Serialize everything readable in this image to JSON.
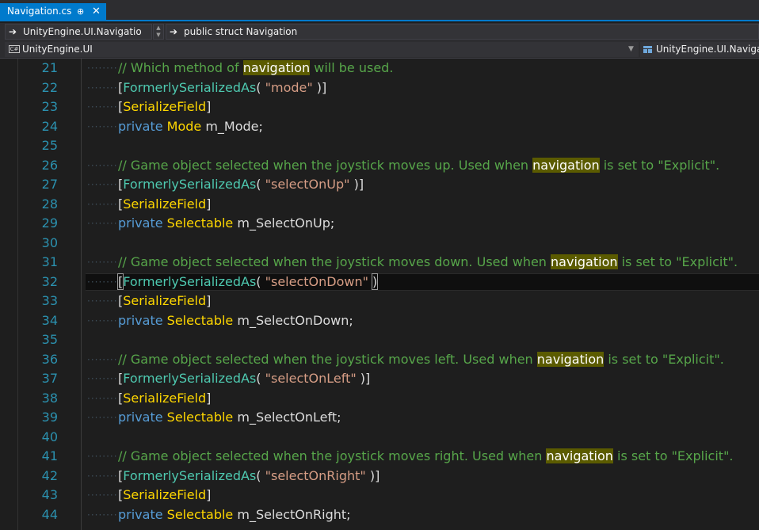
{
  "tab": {
    "title": "Navigation.cs",
    "pin": "⊕",
    "close": "✕"
  },
  "nav": {
    "left_dropdown": "UnityEngine.UI.Navigatio",
    "right_dropdown": "public struct Navigation",
    "project": "UnityEngine.UI",
    "member": "UnityEngine.UI.Navigat"
  },
  "lines": [
    {
      "n": "21",
      "parts": [
        [
          "c",
          "// Which method of "
        ],
        [
          "h",
          "navigation"
        ],
        [
          "c",
          " will be used."
        ]
      ]
    },
    {
      "n": "22",
      "parts": [
        [
          "p",
          "["
        ],
        [
          "a",
          "FormerlySerializedAs"
        ],
        [
          "p",
          "( "
        ],
        [
          "s",
          "\"mode\""
        ],
        [
          "p",
          " )]"
        ]
      ]
    },
    {
      "n": "23",
      "parts": [
        [
          "p",
          "["
        ],
        [
          "f",
          "SerializeField"
        ],
        [
          "p",
          "]"
        ]
      ]
    },
    {
      "n": "24",
      "parts": [
        [
          "k",
          "private "
        ],
        [
          "t",
          "Mode"
        ],
        [
          "p",
          " m_Mode;"
        ]
      ]
    },
    {
      "n": "25",
      "parts": []
    },
    {
      "n": "26",
      "parts": [
        [
          "c",
          "// Game object selected when the joystick moves up. Used when "
        ],
        [
          "h",
          "navigation"
        ],
        [
          "c",
          " is set to \"Explicit\"."
        ]
      ]
    },
    {
      "n": "27",
      "parts": [
        [
          "p",
          "["
        ],
        [
          "a",
          "FormerlySerializedAs"
        ],
        [
          "p",
          "( "
        ],
        [
          "s",
          "\"selectOnUp\""
        ],
        [
          "p",
          " )]"
        ]
      ]
    },
    {
      "n": "28",
      "parts": [
        [
          "p",
          "["
        ],
        [
          "f",
          "SerializeField"
        ],
        [
          "p",
          "]"
        ]
      ]
    },
    {
      "n": "29",
      "parts": [
        [
          "k",
          "private "
        ],
        [
          "t",
          "Selectable"
        ],
        [
          "p",
          " m_SelectOnUp;"
        ]
      ]
    },
    {
      "n": "30",
      "parts": []
    },
    {
      "n": "31",
      "parts": [
        [
          "c",
          "// Game object selected when the joystick moves down. Used when "
        ],
        [
          "h",
          "navigation"
        ],
        [
          "c",
          " is set to \"Explicit\"."
        ]
      ]
    },
    {
      "n": "32",
      "current": true,
      "parts": [
        [
          "b",
          "["
        ],
        [
          "a",
          "FormerlySerializedAs"
        ],
        [
          "p",
          "( "
        ],
        [
          "s",
          "\"selectOnDown\""
        ],
        [
          "p",
          " "
        ],
        [
          "b",
          ")"
        ]
      ]
    },
    {
      "n": "33",
      "parts": [
        [
          "p",
          "["
        ],
        [
          "f",
          "SerializeField"
        ],
        [
          "p",
          "]"
        ]
      ]
    },
    {
      "n": "34",
      "parts": [
        [
          "k",
          "private "
        ],
        [
          "t",
          "Selectable"
        ],
        [
          "p",
          " m_SelectOnDown;"
        ]
      ]
    },
    {
      "n": "35",
      "parts": []
    },
    {
      "n": "36",
      "parts": [
        [
          "c",
          "// Game object selected when the joystick moves left. Used when "
        ],
        [
          "h",
          "navigation"
        ],
        [
          "c",
          " is set to \"Explicit\"."
        ]
      ]
    },
    {
      "n": "37",
      "parts": [
        [
          "p",
          "["
        ],
        [
          "a",
          "FormerlySerializedAs"
        ],
        [
          "p",
          "( "
        ],
        [
          "s",
          "\"selectOnLeft\""
        ],
        [
          "p",
          " )]"
        ]
      ]
    },
    {
      "n": "38",
      "parts": [
        [
          "p",
          "["
        ],
        [
          "f",
          "SerializeField"
        ],
        [
          "p",
          "]"
        ]
      ]
    },
    {
      "n": "39",
      "parts": [
        [
          "k",
          "private "
        ],
        [
          "t",
          "Selectable"
        ],
        [
          "p",
          " m_SelectOnLeft;"
        ]
      ]
    },
    {
      "n": "40",
      "parts": []
    },
    {
      "n": "41",
      "parts": [
        [
          "c",
          "// Game object selected when the joystick moves right. Used when "
        ],
        [
          "h",
          "navigation"
        ],
        [
          "c",
          " is set to \"Explicit\"."
        ]
      ]
    },
    {
      "n": "42",
      "parts": [
        [
          "p",
          "["
        ],
        [
          "a",
          "FormerlySerializedAs"
        ],
        [
          "p",
          "( "
        ],
        [
          "s",
          "\"selectOnRight\""
        ],
        [
          "p",
          " )]"
        ]
      ]
    },
    {
      "n": "43",
      "parts": [
        [
          "p",
          "["
        ],
        [
          "f",
          "SerializeField"
        ],
        [
          "p",
          "]"
        ]
      ]
    },
    {
      "n": "44",
      "parts": [
        [
          "k",
          "private "
        ],
        [
          "t",
          "Selectable"
        ],
        [
          "p",
          " m_SelectOnRight;"
        ]
      ]
    }
  ],
  "colors": {
    "accent": "#007acc",
    "line_number": "#2b91af",
    "comment": "#57a64a",
    "highlight": "#5b5b00",
    "attribute": "#4ec9b0",
    "field_attribute": "#ffd700",
    "keyword": "#569cd6",
    "string": "#d69d85"
  }
}
